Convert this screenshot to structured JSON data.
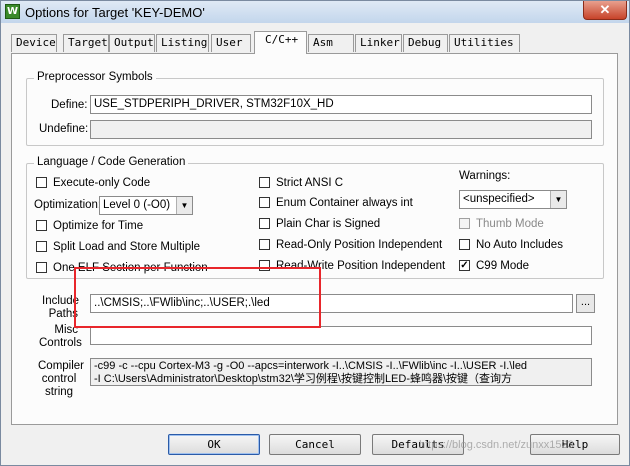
{
  "window": {
    "title": "Options for Target 'KEY-DEMO'",
    "close_glyph": "✕",
    "app_icon_glyph": "W"
  },
  "tabs": [
    {
      "label": "Device"
    },
    {
      "label": "Target"
    },
    {
      "label": "Output"
    },
    {
      "label": "Listing"
    },
    {
      "label": "User"
    },
    {
      "label": "C/C++",
      "active": true
    },
    {
      "label": "Asm"
    },
    {
      "label": "Linker"
    },
    {
      "label": "Debug"
    },
    {
      "label": "Utilities"
    }
  ],
  "preprocessor": {
    "group_label": "Preprocessor Symbols",
    "define_label": "Define:",
    "define_value": "USE_STDPERIPH_DRIVER, STM32F10X_HD",
    "undefine_label": "Undefine:",
    "undefine_value": ""
  },
  "language": {
    "group_label": "Language / Code Generation",
    "execute_only": {
      "label": "Execute-only Code",
      "checked": false
    },
    "optimization_label": "Optimization:",
    "optimization_value": "Level 0 (-O0)",
    "optimize_time": {
      "label": "Optimize for Time",
      "checked": false
    },
    "split_load": {
      "label": "Split Load and Store Multiple",
      "checked": false
    },
    "one_elf": {
      "label": "One ELF Section per Function",
      "checked": false
    },
    "strict_ansi": {
      "label": "Strict ANSI C",
      "checked": false
    },
    "enum_container": {
      "label": "Enum Container always int",
      "checked": false
    },
    "plain_char": {
      "label": "Plain Char is Signed",
      "checked": false
    },
    "read_only_pi": {
      "label": "Read-Only Position Independent",
      "checked": false
    },
    "read_write_pi": {
      "label": "Read-Write Position Independent",
      "checked": false
    },
    "warnings_label": "Warnings:",
    "warnings_value": "<unspecified>",
    "thumb_mode": {
      "label": "Thumb Mode",
      "checked": false,
      "disabled": true
    },
    "no_auto_includes": {
      "label": "No Auto Includes",
      "checked": false
    },
    "c99_mode": {
      "label": "C99 Mode",
      "checked": true
    }
  },
  "include": {
    "label_line1": "Include",
    "label_line2": "Paths",
    "value": "..\\CMSIS;..\\FWlib\\inc;..\\USER;.\\led",
    "browse_label": "..."
  },
  "misc": {
    "label_line1": "Misc",
    "label_line2": "Controls",
    "value": ""
  },
  "compiler": {
    "label_line1": "Compiler",
    "label_line2": "control",
    "label_line3": "string",
    "line1": "-c99 -c --cpu Cortex-M3 -g -O0 --apcs=interwork -I..\\CMSIS -I..\\FWlib\\inc -I..\\USER -I.\\led",
    "line2": "-I C:\\Users\\Administrator\\Desktop\\stm32\\学习例程\\按键控制LED-蜂鸣器\\按键（查询方"
  },
  "buttons": {
    "ok": "OK",
    "cancel": "Cancel",
    "defaults": "Defaults",
    "help": "Help"
  },
  "watermark": "https://blog.csdn.net/zunxx1523"
}
